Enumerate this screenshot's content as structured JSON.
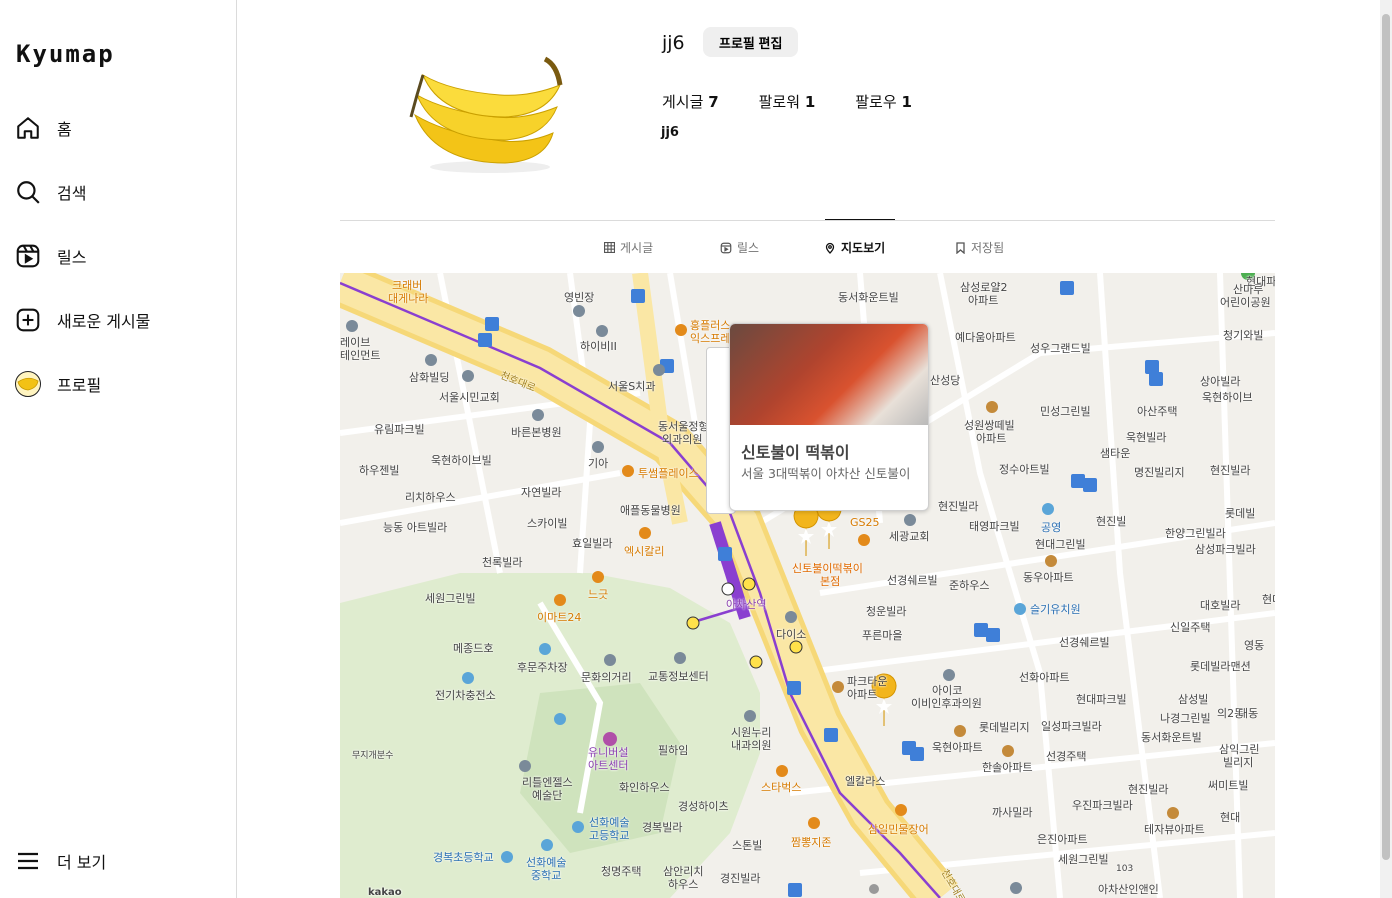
{
  "sidebar": {
    "logo": "Kyumap",
    "items": [
      {
        "label": "홈",
        "icon": "home-icon"
      },
      {
        "label": "검색",
        "icon": "search-icon"
      },
      {
        "label": "릴스",
        "icon": "reels-icon"
      },
      {
        "label": "새로운 게시물",
        "icon": "plus-square-icon"
      },
      {
        "label": "프로필",
        "icon": "profile-avatar"
      }
    ],
    "more_label": "더 보기"
  },
  "profile": {
    "username": "jj6",
    "edit_label": "프로필 편집",
    "stats": {
      "posts_label": "게시글",
      "posts": "7",
      "followers_label": "팔로워",
      "followers": "1",
      "following_label": "팔로우",
      "following": "1"
    },
    "display_name": "jj6"
  },
  "tabs": [
    {
      "label": "게시글",
      "icon": "grid-icon",
      "active": false
    },
    {
      "label": "릴스",
      "icon": "reels-icon",
      "active": false
    },
    {
      "label": "지도보기",
      "icon": "map-pin-icon",
      "active": true
    },
    {
      "label": "저장됨",
      "icon": "bookmark-icon",
      "active": false
    }
  ],
  "map": {
    "popup": {
      "title": "신토불이 떡볶이",
      "description": "서울 3대떡볶이 아차산 신토불이"
    },
    "labels": {
      "l1": "크래버",
      "l1b": "대게나라",
      "l2": "영빈장",
      "l3": "동서화운트빌",
      "l4": "삼성로얄2",
      "l4b": "아파트",
      "l5": "산마루",
      "l5b": "어린이공원",
      "l6": "예다움아파트",
      "l7": "성우그랜드빌",
      "l8": "청기와빌",
      "l9": "하이비II",
      "l10": "서울S치과",
      "l11": "산성당",
      "l12": "상아빌라",
      "l13": "욱현하이브",
      "l14": "삼화빌딩",
      "l15": "서울시민교회",
      "l16": "민성그린빌",
      "l17": "아산주택",
      "l18": "유림파크빌",
      "l19": "바른본병원",
      "l20": "성원쌍떼빌",
      "l20b": "아파트",
      "l21": "욱현빌라",
      "l22": "샘타운",
      "l23": "하우젠빌",
      "l24": "욱현하이브빌",
      "l25": "기아",
      "l26": "투썸플레이스",
      "l27": "정수아트빌",
      "l28": "명진빌리지",
      "l29": "현진빌라",
      "l30": "리치하우스",
      "l31": "자연빌라",
      "l32": "애플동물병원",
      "l33": "현진빌라",
      "l34": "스카이빌",
      "l35": "효일빌라",
      "l36": "GS25",
      "l37": "세광교회",
      "l38": "태영파크빌",
      "l39": "공영",
      "l40": "현진빌",
      "l41": "한양그린빌라",
      "l42": "능동 아트빌라",
      "l43": "엑시칼리",
      "l44": "신토불이떡볶이",
      "l44b": "본점",
      "l45": "현대그린빌",
      "l46": "삼성파크빌라",
      "l47": "천록빌라",
      "l48": "선경쉐르빌",
      "l49": "준하우스",
      "l50": "동우아파트",
      "l51": "느긋",
      "l52": "아차산역",
      "l53": "세원그린빌",
      "l54": "이마트24",
      "l55": "슬기유치원",
      "l56": "대호빌라",
      "l57": "청운빌라",
      "l58": "다이소",
      "l59": "푸른마을",
      "l60": "선경쉐르빌",
      "l61": "신일주택",
      "l62": "메종드호",
      "l63": "후문주차장",
      "l64": "교통정보센터",
      "l65": "문화의거리",
      "l66": "롯데빌라맨션",
      "l67": "파크타운",
      "l67b": "아파트",
      "l68": "전기차충전소",
      "l69": "선화아파트",
      "l70": "아이코",
      "l70b": "이비인후과의원",
      "l71": "현대파크빌",
      "l72": "삼성빌",
      "l73": "나경그린빌",
      "l74": "의2동",
      "l75": "시원누리",
      "l75b": "내과의원",
      "l76": "롯데빌리지",
      "l77": "일성파크빌라",
      "l78": "동서화운트빌",
      "l79": "유니버설",
      "l79b": "아트센터",
      "l80": "필하임",
      "l81": "욱현아파트",
      "l82": "무지개분수",
      "l83": "한솔아파트",
      "l84": "선경주택",
      "l85": "삼익그린",
      "l85b": "빌리지",
      "l86": "엘칼라스",
      "l87": "리틀엔젤스",
      "l87b": "예술단",
      "l88": "화인하우스",
      "l89": "스타벅스",
      "l90": "현진빌라",
      "l91": "써미트빌",
      "l92": "경성하이츠",
      "l93": "까사밀라",
      "l94": "우진파크빌라",
      "l95": "선화예술",
      "l95b": "고등학교",
      "l96": "경복빌라",
      "l97": "짬뽕지존",
      "l98": "삼일민물장어",
      "l99": "테자뷰아파트",
      "l100": "스톤빌",
      "l101": "은진아파트",
      "l102": "경복초등학교",
      "l103": "선화예술",
      "l103b": "중학교",
      "l104": "청명주택",
      "l105": "삼안리치",
      "l105b": "하우스",
      "l106": "경진빌라",
      "l107": "세원그린빌",
      "l108": "아차산인앤인",
      "l109": "레이브",
      "l109b": "테인먼트",
      "l110": "홍플러스",
      "l110b": "익스프레",
      "l111": "동서울정형",
      "l111b": "외과의원",
      "l112": "롯데빌리지",
      "l113": "대동",
      "l114": "영동",
      "l115": "현대파",
      "l116": "현대",
      "l117": "롯데빌",
      "l118": "현대",
      "l119": "103",
      "l120": "천호대로",
      "l121": "천호대로"
    },
    "kakao": "kakao"
  }
}
